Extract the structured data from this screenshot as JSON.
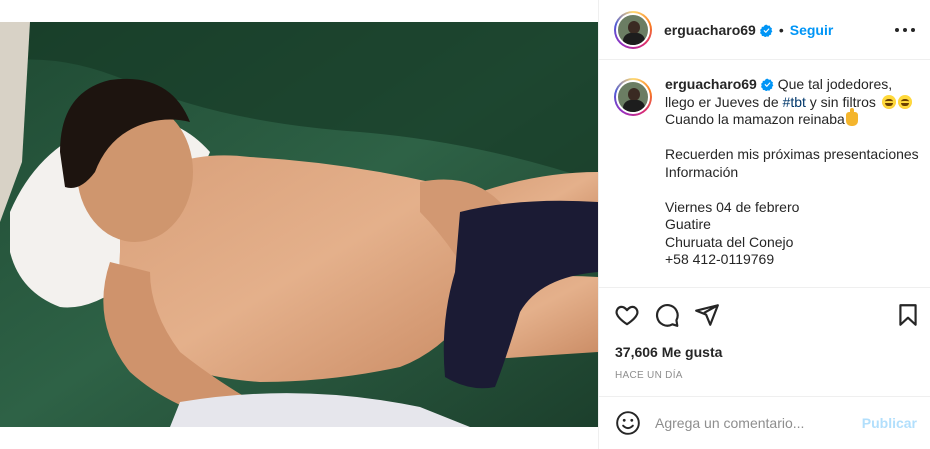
{
  "post": {
    "username": "erguacharo69",
    "follow_label": "Seguir",
    "separator": "•",
    "caption": {
      "username": "erguacharo69",
      "line1": "Que tal jodedores,",
      "line2_before": "llego er Jueves de ",
      "hashtag": "#tbt",
      "line2_after": " y sin filtros ",
      "line3": "Cuando la mamazon reinaba",
      "line5": "Recuerden mis próximas presentaciones",
      "line6": "Información",
      "line8": "Viernes 04 de febrero",
      "line9": "Guatire",
      "line10": "Churuata del Conejo",
      "line11": "+58 412-0119769"
    },
    "likes": "37,606 Me gusta",
    "time": "HACE UN DÍA"
  },
  "comment": {
    "placeholder": "Agrega un comentario...",
    "publish_label": "Publicar"
  },
  "icons": {
    "verified": "verified-badge-icon",
    "more": "more-options-icon",
    "like": "heart-icon",
    "comment": "comment-bubble-icon",
    "share": "paper-plane-icon",
    "save": "bookmark-icon",
    "emoji": "smiley-icon"
  },
  "colors": {
    "accent": "#0095f6",
    "publish_disabled": "#b2dffc",
    "muted": "#8e8e8e",
    "text": "#262626",
    "hashtag": "#00376b"
  }
}
